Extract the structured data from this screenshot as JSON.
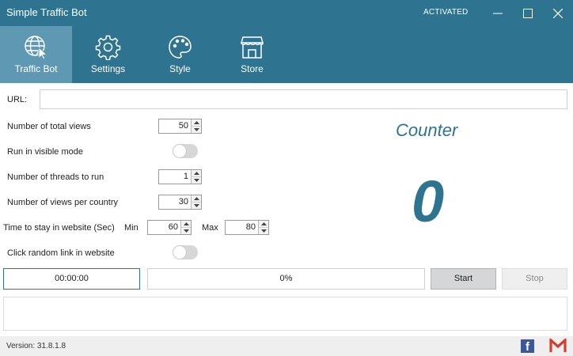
{
  "window": {
    "title": "Simple Traffic Bot",
    "status": "ACTIVATED"
  },
  "nav": {
    "items": [
      {
        "label": "Traffic Bot",
        "icon": "globe-cursor-icon",
        "active": true
      },
      {
        "label": "Settings",
        "icon": "gear-icon",
        "active": false
      },
      {
        "label": "Style",
        "icon": "palette-icon",
        "active": false
      },
      {
        "label": "Store",
        "icon": "store-icon",
        "active": false
      }
    ]
  },
  "form": {
    "url_label": "URL:",
    "url_value": "",
    "total_views_label": "Number of total views",
    "total_views": "50",
    "visible_mode_label": "Run in visible mode",
    "visible_mode_on": false,
    "threads_label": "Number of threads to run",
    "threads": "1",
    "views_per_country_label": "Number of views per country",
    "views_per_country": "30",
    "stay_label": "Time to stay in website (Sec)",
    "min_label": "Min",
    "min_value": "60",
    "max_label": "Max",
    "max_value": "80",
    "random_link_label": "Click random link in website",
    "random_link_on": false
  },
  "counter": {
    "label": "Counter",
    "value": "0"
  },
  "run": {
    "elapsed": "00:00:00",
    "progress_text": "0%",
    "progress_fraction": 0,
    "start_label": "Start",
    "stop_label": "Stop"
  },
  "log": {
    "text": ""
  },
  "footer": {
    "version": "Version: 31.8.1.8",
    "facebook_letter": "f"
  },
  "colors": {
    "accent": "#2e7390",
    "nav_active": "#5f98b2",
    "facebook": "#3b5998",
    "gmail_red": "#d23f31"
  }
}
